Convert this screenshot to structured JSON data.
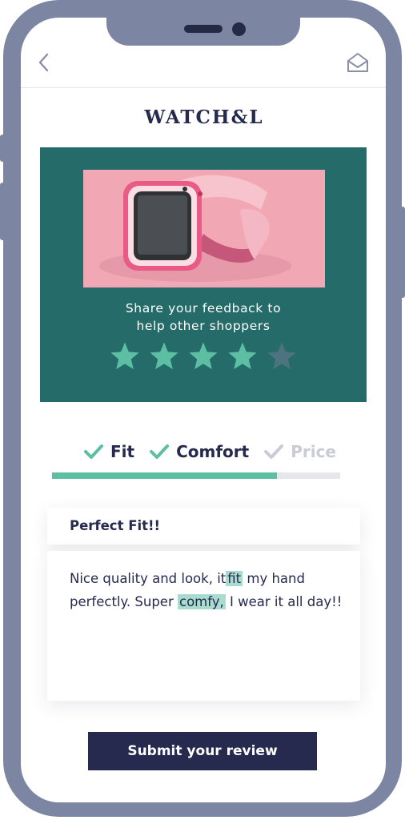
{
  "brand": {
    "logo_text": "WATCH&L"
  },
  "header": {
    "back_icon": "chevron-left-icon",
    "mail_icon": "envelope-open-icon"
  },
  "hero": {
    "prompt_line1": "Share your feedback to",
    "prompt_line2": "help other shoppers",
    "rating": {
      "value": 4,
      "max": 5
    },
    "colors": {
      "background": "#256b69",
      "star_on": "#5cbfa4",
      "star_off": "#4b7480"
    }
  },
  "criteria": [
    {
      "label": "Fit",
      "checked": true
    },
    {
      "label": "Comfort",
      "checked": true
    },
    {
      "label": "Price",
      "checked": false
    }
  ],
  "progress": {
    "completed_fraction": 0.78,
    "fill_color": "#5cbfa4"
  },
  "review": {
    "title": "Perfect Fit!!",
    "body_part1": "Nice quality and look, it",
    "highlight1": "fit",
    "body_part2": " my hand perfectly. Super",
    "highlight2": "comfy,",
    "body_part3": " I wear it all day!!"
  },
  "submit": {
    "label": "Submit your review"
  },
  "colors": {
    "navy": "#262a4f",
    "teal": "#5cbfa4",
    "muted": "#c9cbd6",
    "phone_frame": "#7c86a3"
  }
}
